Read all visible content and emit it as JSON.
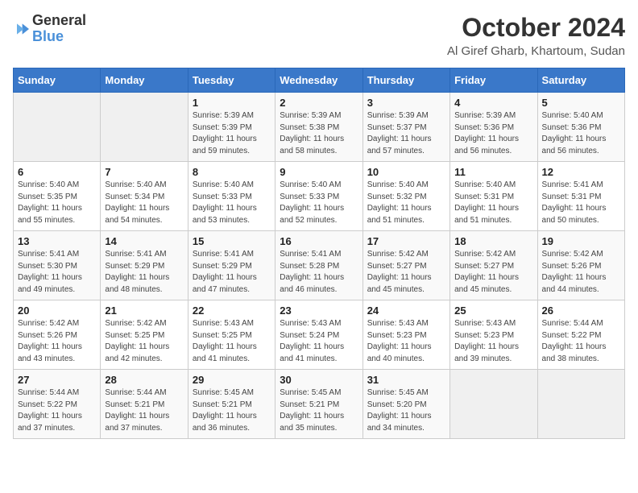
{
  "logo": {
    "general": "General",
    "blue": "Blue"
  },
  "title": "October 2024",
  "location": "Al Giref Gharb, Khartoum, Sudan",
  "days_header": [
    "Sunday",
    "Monday",
    "Tuesday",
    "Wednesday",
    "Thursday",
    "Friday",
    "Saturday"
  ],
  "weeks": [
    [
      {
        "day": "",
        "sunrise": "",
        "sunset": "",
        "daylight": ""
      },
      {
        "day": "",
        "sunrise": "",
        "sunset": "",
        "daylight": ""
      },
      {
        "day": "1",
        "sunrise": "Sunrise: 5:39 AM",
        "sunset": "Sunset: 5:39 PM",
        "daylight": "Daylight: 11 hours and 59 minutes."
      },
      {
        "day": "2",
        "sunrise": "Sunrise: 5:39 AM",
        "sunset": "Sunset: 5:38 PM",
        "daylight": "Daylight: 11 hours and 58 minutes."
      },
      {
        "day": "3",
        "sunrise": "Sunrise: 5:39 AM",
        "sunset": "Sunset: 5:37 PM",
        "daylight": "Daylight: 11 hours and 57 minutes."
      },
      {
        "day": "4",
        "sunrise": "Sunrise: 5:39 AM",
        "sunset": "Sunset: 5:36 PM",
        "daylight": "Daylight: 11 hours and 56 minutes."
      },
      {
        "day": "5",
        "sunrise": "Sunrise: 5:40 AM",
        "sunset": "Sunset: 5:36 PM",
        "daylight": "Daylight: 11 hours and 56 minutes."
      }
    ],
    [
      {
        "day": "6",
        "sunrise": "Sunrise: 5:40 AM",
        "sunset": "Sunset: 5:35 PM",
        "daylight": "Daylight: 11 hours and 55 minutes."
      },
      {
        "day": "7",
        "sunrise": "Sunrise: 5:40 AM",
        "sunset": "Sunset: 5:34 PM",
        "daylight": "Daylight: 11 hours and 54 minutes."
      },
      {
        "day": "8",
        "sunrise": "Sunrise: 5:40 AM",
        "sunset": "Sunset: 5:33 PM",
        "daylight": "Daylight: 11 hours and 53 minutes."
      },
      {
        "day": "9",
        "sunrise": "Sunrise: 5:40 AM",
        "sunset": "Sunset: 5:33 PM",
        "daylight": "Daylight: 11 hours and 52 minutes."
      },
      {
        "day": "10",
        "sunrise": "Sunrise: 5:40 AM",
        "sunset": "Sunset: 5:32 PM",
        "daylight": "Daylight: 11 hours and 51 minutes."
      },
      {
        "day": "11",
        "sunrise": "Sunrise: 5:40 AM",
        "sunset": "Sunset: 5:31 PM",
        "daylight": "Daylight: 11 hours and 51 minutes."
      },
      {
        "day": "12",
        "sunrise": "Sunrise: 5:41 AM",
        "sunset": "Sunset: 5:31 PM",
        "daylight": "Daylight: 11 hours and 50 minutes."
      }
    ],
    [
      {
        "day": "13",
        "sunrise": "Sunrise: 5:41 AM",
        "sunset": "Sunset: 5:30 PM",
        "daylight": "Daylight: 11 hours and 49 minutes."
      },
      {
        "day": "14",
        "sunrise": "Sunrise: 5:41 AM",
        "sunset": "Sunset: 5:29 PM",
        "daylight": "Daylight: 11 hours and 48 minutes."
      },
      {
        "day": "15",
        "sunrise": "Sunrise: 5:41 AM",
        "sunset": "Sunset: 5:29 PM",
        "daylight": "Daylight: 11 hours and 47 minutes."
      },
      {
        "day": "16",
        "sunrise": "Sunrise: 5:41 AM",
        "sunset": "Sunset: 5:28 PM",
        "daylight": "Daylight: 11 hours and 46 minutes."
      },
      {
        "day": "17",
        "sunrise": "Sunrise: 5:42 AM",
        "sunset": "Sunset: 5:27 PM",
        "daylight": "Daylight: 11 hours and 45 minutes."
      },
      {
        "day": "18",
        "sunrise": "Sunrise: 5:42 AM",
        "sunset": "Sunset: 5:27 PM",
        "daylight": "Daylight: 11 hours and 45 minutes."
      },
      {
        "day": "19",
        "sunrise": "Sunrise: 5:42 AM",
        "sunset": "Sunset: 5:26 PM",
        "daylight": "Daylight: 11 hours and 44 minutes."
      }
    ],
    [
      {
        "day": "20",
        "sunrise": "Sunrise: 5:42 AM",
        "sunset": "Sunset: 5:26 PM",
        "daylight": "Daylight: 11 hours and 43 minutes."
      },
      {
        "day": "21",
        "sunrise": "Sunrise: 5:42 AM",
        "sunset": "Sunset: 5:25 PM",
        "daylight": "Daylight: 11 hours and 42 minutes."
      },
      {
        "day": "22",
        "sunrise": "Sunrise: 5:43 AM",
        "sunset": "Sunset: 5:25 PM",
        "daylight": "Daylight: 11 hours and 41 minutes."
      },
      {
        "day": "23",
        "sunrise": "Sunrise: 5:43 AM",
        "sunset": "Sunset: 5:24 PM",
        "daylight": "Daylight: 11 hours and 41 minutes."
      },
      {
        "day": "24",
        "sunrise": "Sunrise: 5:43 AM",
        "sunset": "Sunset: 5:23 PM",
        "daylight": "Daylight: 11 hours and 40 minutes."
      },
      {
        "day": "25",
        "sunrise": "Sunrise: 5:43 AM",
        "sunset": "Sunset: 5:23 PM",
        "daylight": "Daylight: 11 hours and 39 minutes."
      },
      {
        "day": "26",
        "sunrise": "Sunrise: 5:44 AM",
        "sunset": "Sunset: 5:22 PM",
        "daylight": "Daylight: 11 hours and 38 minutes."
      }
    ],
    [
      {
        "day": "27",
        "sunrise": "Sunrise: 5:44 AM",
        "sunset": "Sunset: 5:22 PM",
        "daylight": "Daylight: 11 hours and 37 minutes."
      },
      {
        "day": "28",
        "sunrise": "Sunrise: 5:44 AM",
        "sunset": "Sunset: 5:21 PM",
        "daylight": "Daylight: 11 hours and 37 minutes."
      },
      {
        "day": "29",
        "sunrise": "Sunrise: 5:45 AM",
        "sunset": "Sunset: 5:21 PM",
        "daylight": "Daylight: 11 hours and 36 minutes."
      },
      {
        "day": "30",
        "sunrise": "Sunrise: 5:45 AM",
        "sunset": "Sunset: 5:21 PM",
        "daylight": "Daylight: 11 hours and 35 minutes."
      },
      {
        "day": "31",
        "sunrise": "Sunrise: 5:45 AM",
        "sunset": "Sunset: 5:20 PM",
        "daylight": "Daylight: 11 hours and 34 minutes."
      },
      {
        "day": "",
        "sunrise": "",
        "sunset": "",
        "daylight": ""
      },
      {
        "day": "",
        "sunrise": "",
        "sunset": "",
        "daylight": ""
      }
    ]
  ]
}
